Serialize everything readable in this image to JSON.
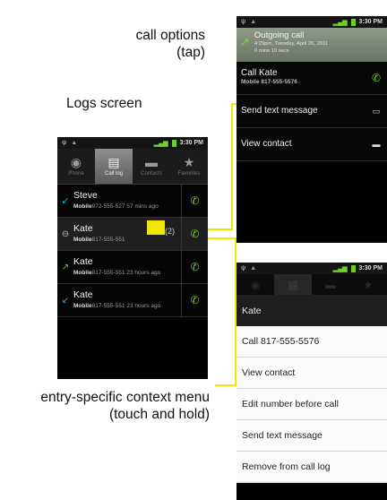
{
  "captions": {
    "call_options_line1": "call options",
    "call_options_line2": "(tap)",
    "logs_screen": "Logs screen",
    "context_line1": "entry-specific context menu",
    "context_line2": "(touch and hold)"
  },
  "status_bar": {
    "time": "3:30 PM"
  },
  "logs": {
    "tabs": [
      {
        "label": "Phone",
        "icon": "phone-icon"
      },
      {
        "label": "Call log",
        "icon": "call-log-icon"
      },
      {
        "label": "Contacts",
        "icon": "contacts-icon"
      },
      {
        "label": "Favorites",
        "icon": "favorites-icon"
      }
    ],
    "entries": [
      {
        "name": "Steve",
        "type": "Mobile",
        "number": "972-555-527",
        "time": "57 mins ago",
        "call_type": "incoming"
      },
      {
        "name": "Kate",
        "type": "Mobile",
        "number": "817-555-551",
        "time": "(2)",
        "call_type": "missed"
      },
      {
        "name": "Kate",
        "type": "Mobile",
        "number": "817-555-551",
        "time": "23 hours ago",
        "call_type": "outgoing"
      },
      {
        "name": "Kate",
        "type": "Mobile",
        "number": "817-555-551",
        "time": "23 hours ago",
        "call_type": "incoming"
      }
    ]
  },
  "call_options": {
    "header_title": "Outgoing call",
    "header_datetime": "4:29pm, Tuesday, April 26, 2011",
    "header_duration": "0 mins 10 secs",
    "call_label": "Call Kate",
    "call_sub": "Mobile 817-555-5576",
    "send_text": "Send text message",
    "view_contact": "View contact"
  },
  "context_menu": {
    "title": "Kate",
    "items": [
      "Call 817-555-5576",
      "View contact",
      "Edit number before call",
      "Send text message",
      "Remove from call log"
    ]
  },
  "colors": {
    "accent_highlight": "#f2e600",
    "call_green": "#6fcf2a",
    "incoming_blue": "#2fa3e6"
  }
}
